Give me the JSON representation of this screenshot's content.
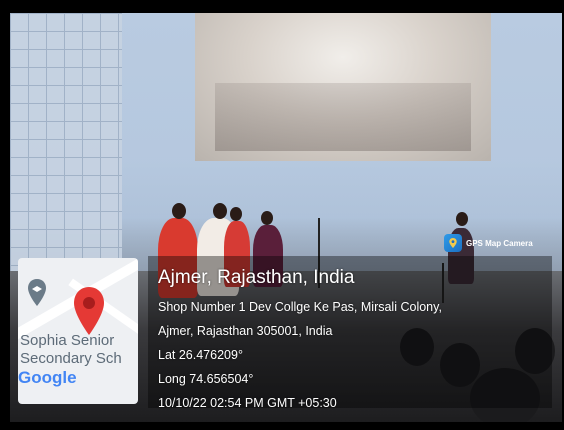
{
  "gps_badge": {
    "label": "GPS Map Camera",
    "icon": "camera-icon"
  },
  "map": {
    "place_line1": "Sophia Senior",
    "place_line2": "Secondary Sch",
    "google_logo": "Google",
    "pin_icon": "map-pin-icon",
    "place_icon": "school-marker-icon"
  },
  "location": {
    "title": "Ajmer, Rajasthan, India",
    "address_line1": "Shop Number 1 Dev Collge Ke Pas, Mirsali Colony,",
    "address_line2": "Ajmer, Rajasthan 305001, India",
    "lat": "Lat 26.476209°",
    "long": "Long 74.656504°",
    "datetime": "10/10/22 02:54 PM GMT +05:30"
  },
  "colors": {
    "pin": "#e53935",
    "google_blue": "#4285F4",
    "google_red": "#EA4335",
    "google_yellow": "#FBBC05",
    "google_green": "#34A853"
  }
}
